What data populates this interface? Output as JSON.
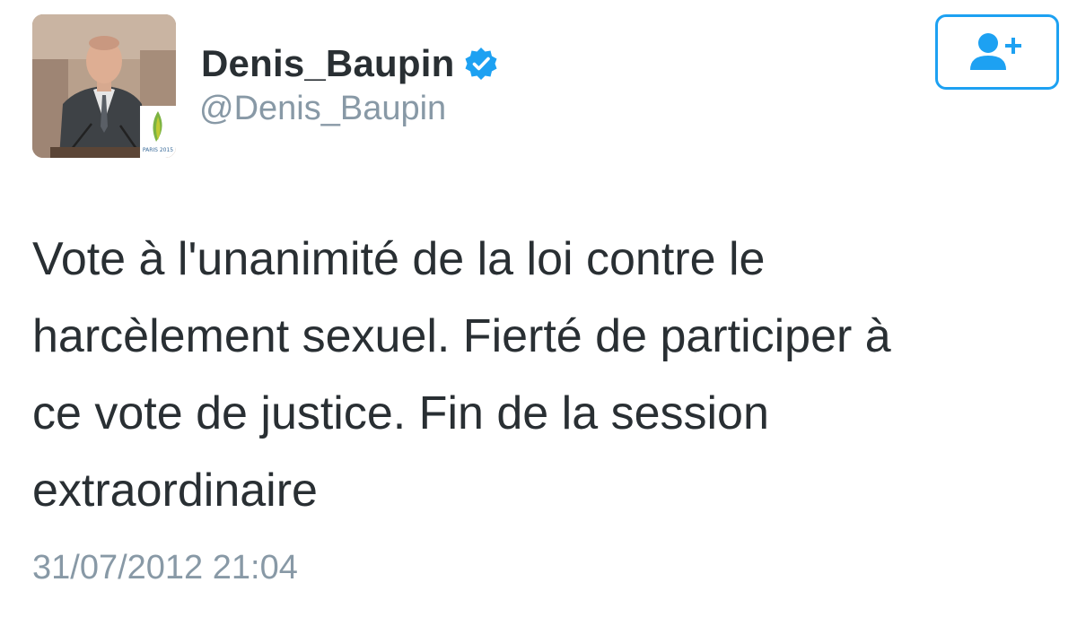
{
  "author": {
    "display_name": "Denis_Baupin",
    "handle": "@Denis_Baupin",
    "verified": true,
    "avatar_badge_text": "PARIS 2015"
  },
  "follow_button": {
    "icon": "add-user-icon"
  },
  "tweet": {
    "text": "Vote à l'unanimité de la loi contre le\nharcèlement sexuel. Fierté de participer à\nce vote de justice. Fin de la session\nextraordinaire",
    "timestamp": "31/07/2012 21:04"
  },
  "colors": {
    "accent": "#1da1f2",
    "text": "#292f33",
    "muted": "#8899a6"
  }
}
